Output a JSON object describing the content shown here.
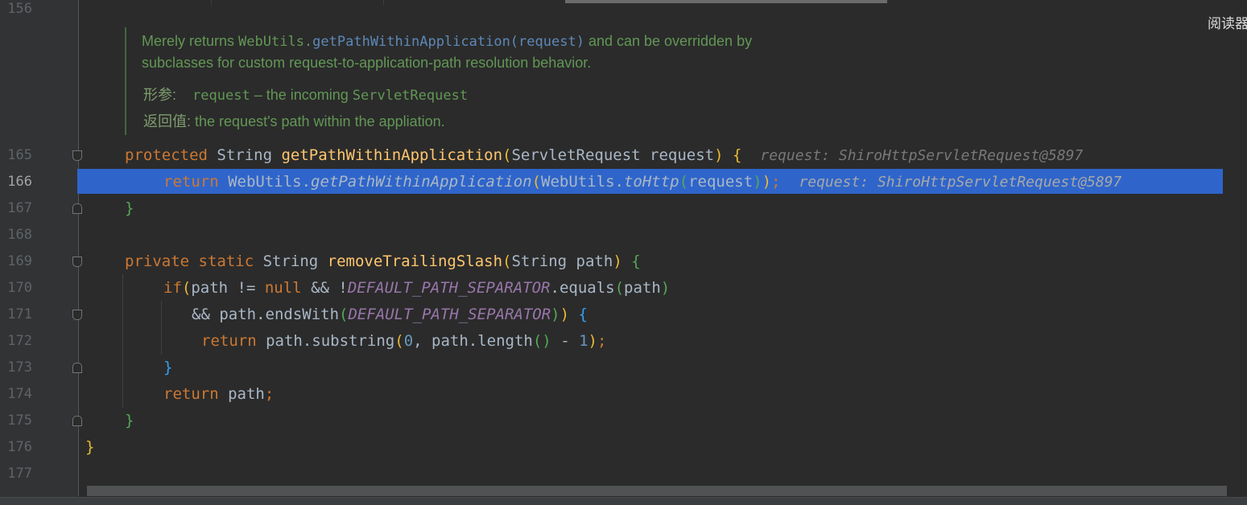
{
  "top_right": {
    "reader_mode_label": "阅读器"
  },
  "gutter": {
    "line_numbers": [
      "156",
      "165",
      "166",
      "167",
      "168",
      "169",
      "170",
      "171",
      "172",
      "173",
      "174",
      "175",
      "176",
      "177"
    ],
    "current_line": "166"
  },
  "doc_comment": {
    "line1_text1": "Merely returns ",
    "line1_class": "WebUtils.",
    "line1_method": "getPathWithinApplication(request)",
    "line1_text2": " and can be overridden by",
    "line2": "subclasses for custom request-to-application-path resolution behavior.",
    "param_label": "形参:",
    "param_name": "request",
    "param_desc": " – the incoming ",
    "param_type": "ServletRequest",
    "return_label": "返回值:",
    "return_desc": " the request's path within the appliation."
  },
  "code": {
    "l165": {
      "kw": "protected",
      "type": " String ",
      "fn": "getPathWithinApplication",
      "params": "ServletRequest request",
      "hint": "request: ShiroHttpServletRequest@5897"
    },
    "l166": {
      "kw": "return",
      "cls1": " WebUtils.",
      "m1": "getPathWithinApplication",
      "cls2": "WebUtils.",
      "m2": "toHttp",
      "arg": "request",
      "semi": ";",
      "hint": "request: ShiroHttpServletRequest@5897"
    },
    "l167": {
      "brace": "}"
    },
    "l169": {
      "kw": "private static",
      "type": " String ",
      "fn": "removeTrailingSlash",
      "params": "String path"
    },
    "l170": {
      "kw_if": "if",
      "path": "path != ",
      "kw_null": "null",
      "and": " && !",
      "const": "DEFAULT_PATH_SEPARATOR",
      "equals": ".equals",
      "arg": "path"
    },
    "l171": {
      "and": "&& path.endsWith",
      "const": "DEFAULT_PATH_SEPARATOR"
    },
    "l172": {
      "kw": "return",
      "expr": " path.substring",
      "zero": "0",
      "mid": ", path.length",
      "minus": " - ",
      "one": "1",
      "semi": ";"
    },
    "l173": {
      "brace": "}"
    },
    "l174": {
      "kw": "return",
      "expr": " path",
      "semi": ";"
    },
    "l175": {
      "brace": "}"
    },
    "l176": {
      "brace": "}"
    }
  },
  "colors": {
    "background": "#2b2b2b",
    "gutter": "#313335",
    "keyword": "#cc7832",
    "method": "#ffc66d",
    "constant": "#9876aa",
    "number": "#6897bb",
    "doc": "#629755",
    "highlight": "#2f65ca"
  }
}
